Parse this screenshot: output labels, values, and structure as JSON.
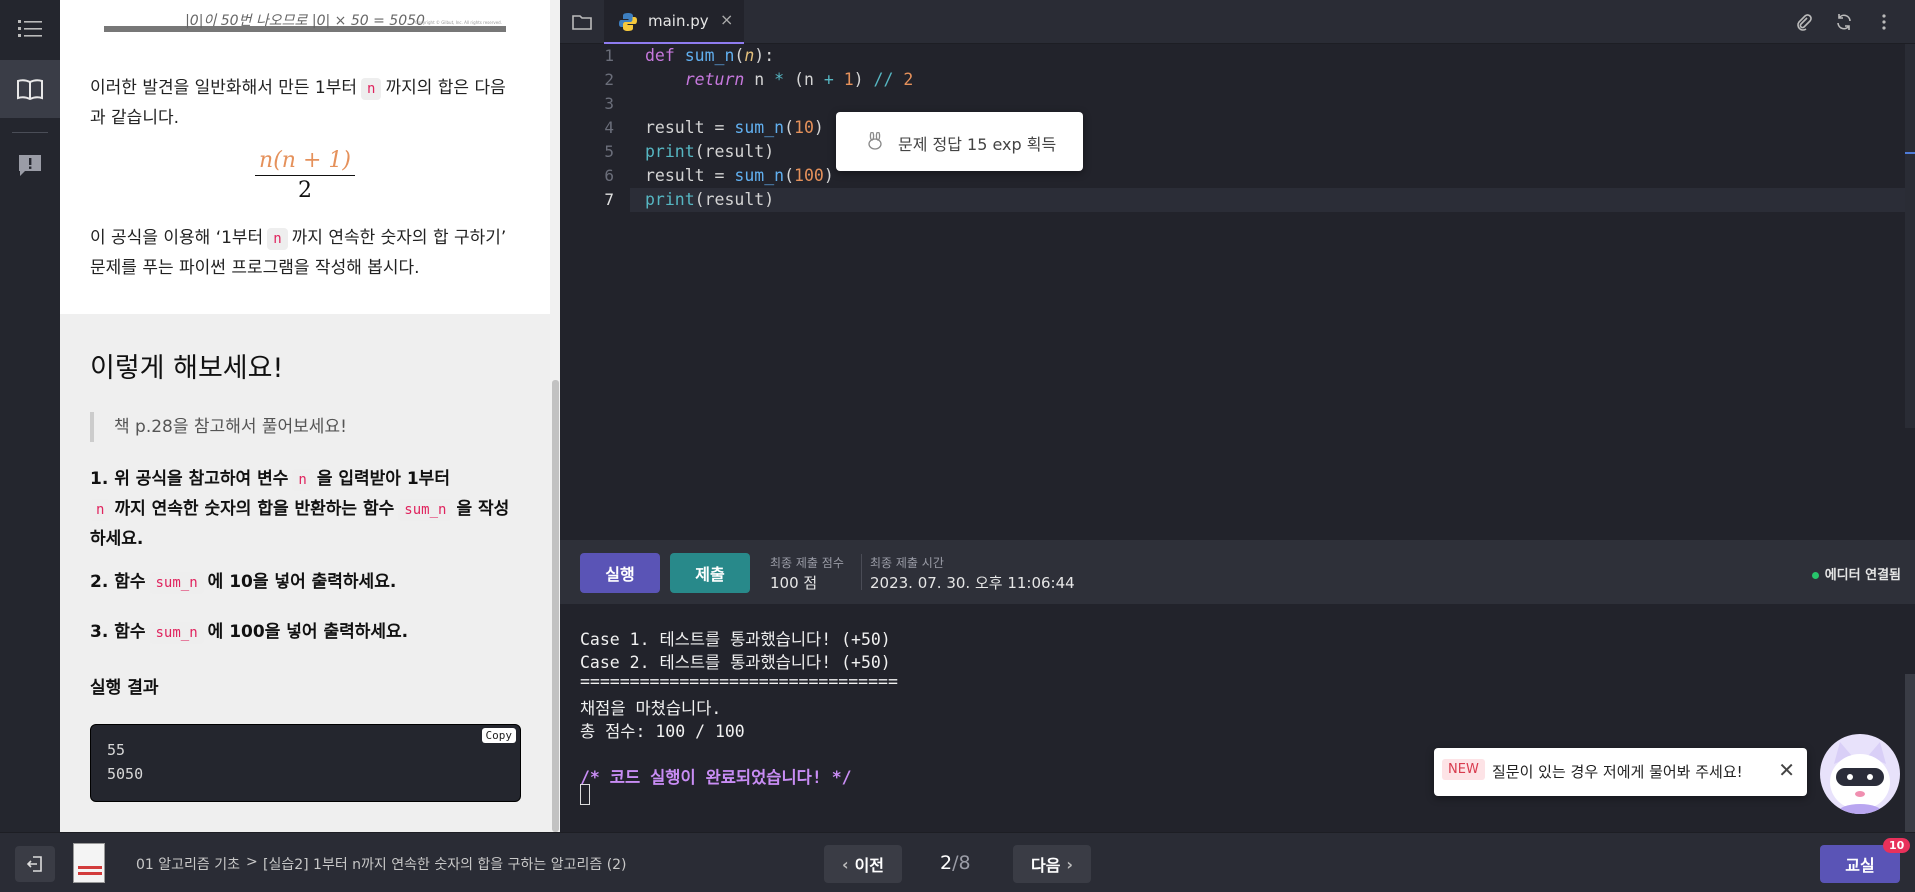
{
  "lesson": {
    "top_image_caption": "|0|이 50번 나오므로 |0| × 50 = 5050",
    "top_image_copyright": "Copyright © Gilbut, Inc. All rights reserved.",
    "para1_a": "이러한 발견을 일반화해서 만든 1부터",
    "para1_var": "n",
    "para1_b": "까지의 합은 다음과 같습니다.",
    "formula_numerator": "n(n + 1)",
    "formula_denominator": "2",
    "para2_a": "이 공식을 이용해 ‘1부터",
    "para2_var": "n",
    "para2_b": "까지 연속한 숫자의 합 구하기’ 문제를 푸는 파이썬 프로그램을 작성해 봅시다."
  },
  "tryit": {
    "title": "이렇게 해보세요!",
    "quote": "책 p.28을 참고해서 풀어보세요!",
    "task1_a": "1. 위 공식을 참고하여 변수",
    "task1_var": "n",
    "task1_b": "을 입력받아 1부터",
    "task1_var2": "n",
    "task1_c": "까지 연속한 숫자의 합을 반환하는 함수",
    "task1_fn": "sum_n",
    "task1_d": "을 작성하세요.",
    "task2_a": "2. 함수",
    "task2_fn": "sum_n",
    "task2_b": "에 10을 넣어 출력하세요.",
    "task3_a": "3. 함수",
    "task3_fn": "sum_n",
    "task3_b": "에 100을 넣어 출력하세요.",
    "result_label": "실행 결과",
    "result_lines": [
      "55",
      "5050"
    ],
    "copy_label": "Copy"
  },
  "editor": {
    "tab_name": "main.py",
    "tab_close": "×",
    "line_numbers": [
      "1",
      "2",
      "3",
      "4",
      "5",
      "6",
      "7"
    ],
    "code": {
      "l1_kw": "def",
      "l1_fn": "sum_n",
      "l1_param": "n",
      "l2_kw": "return",
      "l2_a": " n ",
      "l2_op1": "*",
      "l2_b": " (n ",
      "l2_op2": "+",
      "l2_num1": " 1",
      "l2_c": ") ",
      "l2_op3": "//",
      "l2_num2": " 2",
      "l4_a": "result = ",
      "l4_fn": "sum_n",
      "l4_num": "10",
      "l5_blt": "print",
      "l5_arg": "(result)",
      "l6_a": "result = ",
      "l6_fn": "sum_n",
      "l6_num": "100",
      "l7_blt": "print",
      "l7_arg": "(result)"
    },
    "toast_text": "문제 정답 15 exp 획득"
  },
  "runbar": {
    "run_label": "실행",
    "submit_label": "제출",
    "score_label": "최종 제출 점수",
    "score_value": "100 점",
    "time_label": "최종 제출 시간",
    "time_value": "2023. 07. 30. 오후 11:06:44",
    "status": "에디터 연결됨"
  },
  "console": {
    "lines": [
      "Case 1. 테스트를 통과했습니다! (+50)",
      "Case 2. 테스트를 통과했습니다! (+50)",
      "================================",
      "채점을 마쳤습니다.",
      "총 점수: 100 / 100"
    ],
    "done": "/* 코드 실행이 완료되었습니다! */"
  },
  "chat": {
    "badge": "NEW",
    "text": "질문이 있는 경우 저에게 물어봐 주세요!"
  },
  "footer": {
    "crumb_chapter": "01 알고리즘 기초",
    "crumb_sep": ">",
    "crumb_lesson": "[실습2] 1부터 n까지 연속한 숫자의 합을 구하는 알고리즘 (2)",
    "prev_label": "이전",
    "next_label": "다음",
    "page_current": "2",
    "page_total": "/8",
    "class_label": "교실",
    "class_badge": "10"
  },
  "colors": {
    "accent": "#5a54b6",
    "submit": "#28898a",
    "status_ok": "#27c46b",
    "badge": "#e8315b"
  }
}
